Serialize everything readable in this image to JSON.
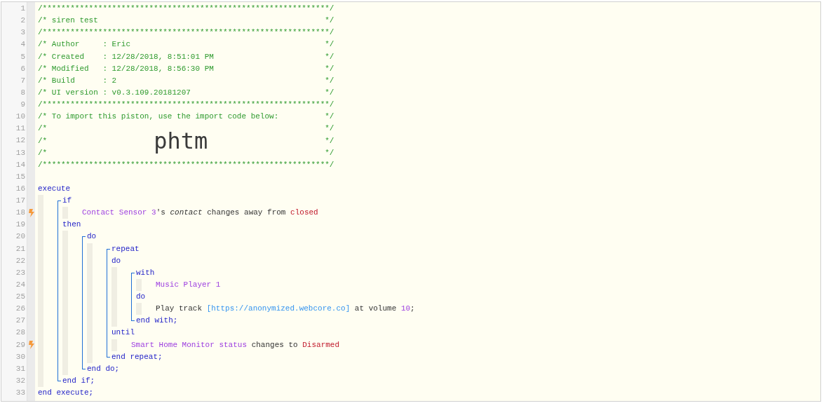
{
  "editor": {
    "lines": [
      {
        "number": "1",
        "kind": "comment",
        "text": "/**************************************************************/"
      },
      {
        "number": "2",
        "kind": "comment",
        "text": "/* siren test",
        "end": "*/"
      },
      {
        "number": "3",
        "kind": "comment",
        "text": "/**************************************************************/"
      },
      {
        "number": "4",
        "kind": "comment",
        "text": "/* Author     : Eric",
        "end": "*/"
      },
      {
        "number": "5",
        "kind": "comment",
        "text": "/* Created    : 12/28/2018, 8:51:01 PM",
        "end": "*/"
      },
      {
        "number": "6",
        "kind": "comment",
        "text": "/* Modified   : 12/28/2018, 8:56:30 PM",
        "end": "*/"
      },
      {
        "number": "7",
        "kind": "comment",
        "text": "/* Build      : 2",
        "end": "*/"
      },
      {
        "number": "8",
        "kind": "comment",
        "text": "/* UI version : v0.3.109.20181207",
        "end": "*/"
      },
      {
        "number": "9",
        "kind": "comment",
        "text": "/**************************************************************/"
      },
      {
        "number": "10",
        "kind": "comment",
        "text": "/* To import this piston, use the import code below:",
        "end": "*/"
      },
      {
        "number": "11",
        "kind": "comment",
        "text": "/*",
        "end": "*/"
      },
      {
        "number": "12",
        "kind": "import",
        "text": "/*",
        "code": "phtm",
        "end": "*/"
      },
      {
        "number": "13",
        "kind": "comment",
        "text": "/*",
        "end": "*/"
      },
      {
        "number": "14",
        "kind": "comment",
        "text": "/**************************************************************/"
      },
      {
        "number": "15",
        "kind": "blank"
      },
      {
        "number": "16",
        "kind": "code",
        "trigger": false,
        "tokens": [
          {
            "kind": "keyword",
            "text": "execute"
          }
        ],
        "children": [
          {
            "kind": "block",
            "items": [
              {
                "number": "17",
                "kind": "code",
                "trigger": false,
                "tokens": [
                  {
                    "kind": "keyword",
                    "text": "if"
                  }
                ],
                "children": [
                  {
                    "number": "18",
                    "kind": "code",
                    "trigger": true,
                    "tokens": [
                      {
                        "kind": "device",
                        "text": "Contact Sensor 3"
                      },
                      {
                        "kind": "text",
                        "text": "'s "
                      },
                      {
                        "kind": "italic",
                        "text": "contact"
                      },
                      {
                        "kind": "text",
                        "text": " changes away from "
                      },
                      {
                        "kind": "value",
                        "text": "closed"
                      }
                    ]
                  }
                ]
              },
              {
                "number": "19",
                "kind": "code",
                "trigger": false,
                "tokens": [
                  {
                    "kind": "keyword",
                    "text": "then"
                  }
                ],
                "children": [
                  {
                    "kind": "block",
                    "items": [
                      {
                        "number": "20",
                        "kind": "code",
                        "trigger": false,
                        "tokens": [
                          {
                            "kind": "keyword",
                            "text": "do"
                          }
                        ],
                        "children": [
                          {
                            "kind": "block",
                            "items": [
                              {
                                "number": "21",
                                "kind": "code",
                                "trigger": false,
                                "tokens": [
                                  {
                                    "kind": "keyword",
                                    "text": "repeat"
                                  }
                                ]
                              },
                              {
                                "number": "22",
                                "kind": "code",
                                "trigger": false,
                                "tokens": [
                                  {
                                    "kind": "keyword",
                                    "text": "do"
                                  }
                                ],
                                "children": [
                                  {
                                    "kind": "block",
                                    "items": [
                                      {
                                        "number": "23",
                                        "kind": "code",
                                        "trigger": false,
                                        "tokens": [
                                          {
                                            "kind": "keyword",
                                            "text": "with"
                                          }
                                        ],
                                        "children": [
                                          {
                                            "number": "24",
                                            "kind": "code",
                                            "trigger": false,
                                            "tokens": [
                                              {
                                                "kind": "device",
                                                "text": "Music Player 1"
                                              }
                                            ]
                                          }
                                        ]
                                      },
                                      {
                                        "number": "25",
                                        "kind": "code",
                                        "trigger": false,
                                        "tokens": [
                                          {
                                            "kind": "keyword",
                                            "text": "do"
                                          }
                                        ],
                                        "children": [
                                          {
                                            "number": "26",
                                            "kind": "code",
                                            "trigger": false,
                                            "tokens": [
                                              {
                                                "kind": "text",
                                                "text": "Play track "
                                              },
                                              {
                                                "kind": "link",
                                                "text": "[https://anonymized.webcore.co]"
                                              },
                                              {
                                                "kind": "text",
                                                "text": " at volume "
                                              },
                                              {
                                                "kind": "device",
                                                "text": "10"
                                              },
                                              {
                                                "kind": "text",
                                                "text": ";"
                                              }
                                            ]
                                          }
                                        ]
                                      },
                                      {
                                        "number": "27",
                                        "kind": "code",
                                        "trigger": false,
                                        "tokens": [
                                          {
                                            "kind": "keyword",
                                            "text": "end with;"
                                          }
                                        ]
                                      }
                                    ]
                                  }
                                ]
                              },
                              {
                                "number": "28",
                                "kind": "code",
                                "trigger": false,
                                "tokens": [
                                  {
                                    "kind": "keyword",
                                    "text": "until"
                                  }
                                ],
                                "children": [
                                  {
                                    "number": "29",
                                    "kind": "code",
                                    "trigger": true,
                                    "tokens": [
                                      {
                                        "kind": "device",
                                        "text": "Smart Home Monitor status"
                                      },
                                      {
                                        "kind": "text",
                                        "text": " changes to "
                                      },
                                      {
                                        "kind": "value",
                                        "text": "Disarmed"
                                      }
                                    ]
                                  }
                                ]
                              },
                              {
                                "number": "30",
                                "kind": "code",
                                "trigger": false,
                                "tokens": [
                                  {
                                    "kind": "keyword",
                                    "text": "end repeat;"
                                  }
                                ]
                              }
                            ]
                          }
                        ]
                      },
                      {
                        "number": "31",
                        "kind": "code",
                        "trigger": false,
                        "tokens": [
                          {
                            "kind": "keyword",
                            "text": "end do;"
                          }
                        ]
                      }
                    ]
                  }
                ]
              },
              {
                "number": "32",
                "kind": "code",
                "trigger": false,
                "tokens": [
                  {
                    "kind": "keyword",
                    "text": "end if;"
                  }
                ]
              }
            ]
          }
        ]
      },
      {
        "number": "33",
        "kind": "code",
        "trigger": false,
        "tokens": [
          {
            "kind": "keyword",
            "text": "end execute;"
          }
        ]
      }
    ]
  }
}
